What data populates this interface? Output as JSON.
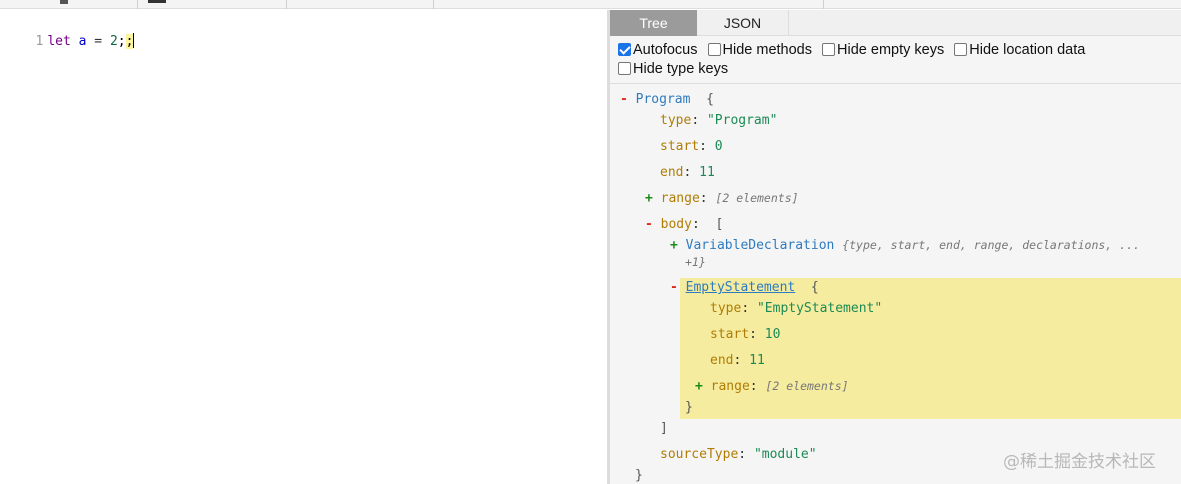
{
  "editor": {
    "line_number": "1",
    "code": {
      "kw": "let",
      "var": "a",
      "op": "=",
      "num": "2",
      "semi1": ";",
      "semi2": ";"
    }
  },
  "tabs": [
    {
      "label": "Tree",
      "active": true
    },
    {
      "label": "JSON",
      "active": false
    }
  ],
  "options": [
    {
      "label": "Autofocus",
      "checked": true
    },
    {
      "label": "Hide methods",
      "checked": false
    },
    {
      "label": "Hide empty keys",
      "checked": false
    },
    {
      "label": "Hide location data",
      "checked": false
    },
    {
      "label": "Hide type keys",
      "checked": false
    }
  ],
  "tree": {
    "program": {
      "node": "Program",
      "open": "{"
    },
    "type": {
      "key": "type",
      "value": "\"Program\""
    },
    "start": {
      "key": "start",
      "value": "0"
    },
    "end": {
      "key": "end",
      "value": "11"
    },
    "range": {
      "key": "range",
      "summary": "[2 elements]"
    },
    "body": {
      "key": "body",
      "open": "["
    },
    "var_decl": {
      "node": "VariableDeclaration",
      "summary1": "{type, start, end, range, declarations, ...",
      "summary2": "+1}"
    },
    "empty": {
      "node": "EmptyStatement",
      "open": "{",
      "type": {
        "key": "type",
        "value": "\"EmptyStatement\""
      },
      "start": {
        "key": "start",
        "value": "10"
      },
      "end": {
        "key": "end",
        "value": "11"
      },
      "range": {
        "key": "range",
        "summary": "[2 elements]"
      },
      "close": "}"
    },
    "body_close": "]",
    "source_type": {
      "key": "sourceType",
      "value": "\"module\""
    },
    "program_close": "}"
  },
  "toggles": {
    "minus": "-",
    "plus": "+"
  },
  "watermark": "@稀土掘金技术社区",
  "colors": {
    "tab_active": "#9b9b9b",
    "highlight": "#f5ec9f",
    "node": "#2e7bc0",
    "key": "#b07d06",
    "value": "#1c8a55"
  }
}
